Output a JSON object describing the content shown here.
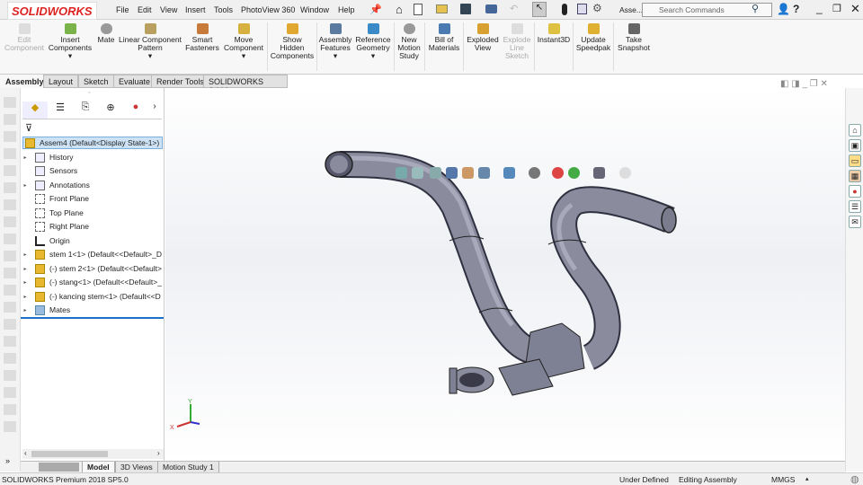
{
  "app": {
    "logo": "SOLIDWORKS",
    "doc_short": "Asse...",
    "search_placeholder": "Search Commands"
  },
  "menu": [
    "File",
    "Edit",
    "View",
    "Insert",
    "Tools",
    "PhotoView 360",
    "Window",
    "Help"
  ],
  "ribbon": [
    {
      "label": "Edit Component",
      "disabled": true
    },
    {
      "label": "Insert Components"
    },
    {
      "label": "Mate"
    },
    {
      "label": "Linear Component Pattern"
    },
    {
      "label": "Smart Fasteners"
    },
    {
      "label": "Move Component"
    },
    {
      "label": "Show Hidden Components"
    },
    {
      "label": "Assembly Features"
    },
    {
      "label": "Reference Geometry"
    },
    {
      "label": "New Motion Study"
    },
    {
      "label": "Bill of Materials"
    },
    {
      "label": "Exploded View"
    },
    {
      "label": "Explode Line Sketch",
      "disabled": true
    },
    {
      "label": "Instant3D"
    },
    {
      "label": "Update Speedpak"
    },
    {
      "label": "Take Snapshot"
    }
  ],
  "tabs": [
    "Assembly",
    "Layout",
    "Sketch",
    "Evaluate",
    "Render Tools",
    "SOLIDWORKS Add-Ins"
  ],
  "tree": {
    "root": "Assem4  (Default<Display State-1>)",
    "items": [
      "History",
      "Sensors",
      "Annotations",
      "Front Plane",
      "Top Plane",
      "Right Plane",
      "Origin",
      "stem 1<1> (Default<<Default>_D",
      "(-) stem 2<1> (Default<<Default>",
      "(-) stang<1> (Default<<Default>_",
      "(-) kancing stem<1> (Default<<D",
      "Mates"
    ]
  },
  "bottom_tabs": [
    "Model",
    "3D Views",
    "Motion Study 1"
  ],
  "status": {
    "version": "SOLIDWORKS Premium 2018 SP5.0",
    "state": "Under Defined",
    "mode": "Editing Assembly",
    "units": "MMGS"
  },
  "colors": {
    "accent": "#1a73c8",
    "logo": "#d22020",
    "model": "#8a8c9e"
  }
}
